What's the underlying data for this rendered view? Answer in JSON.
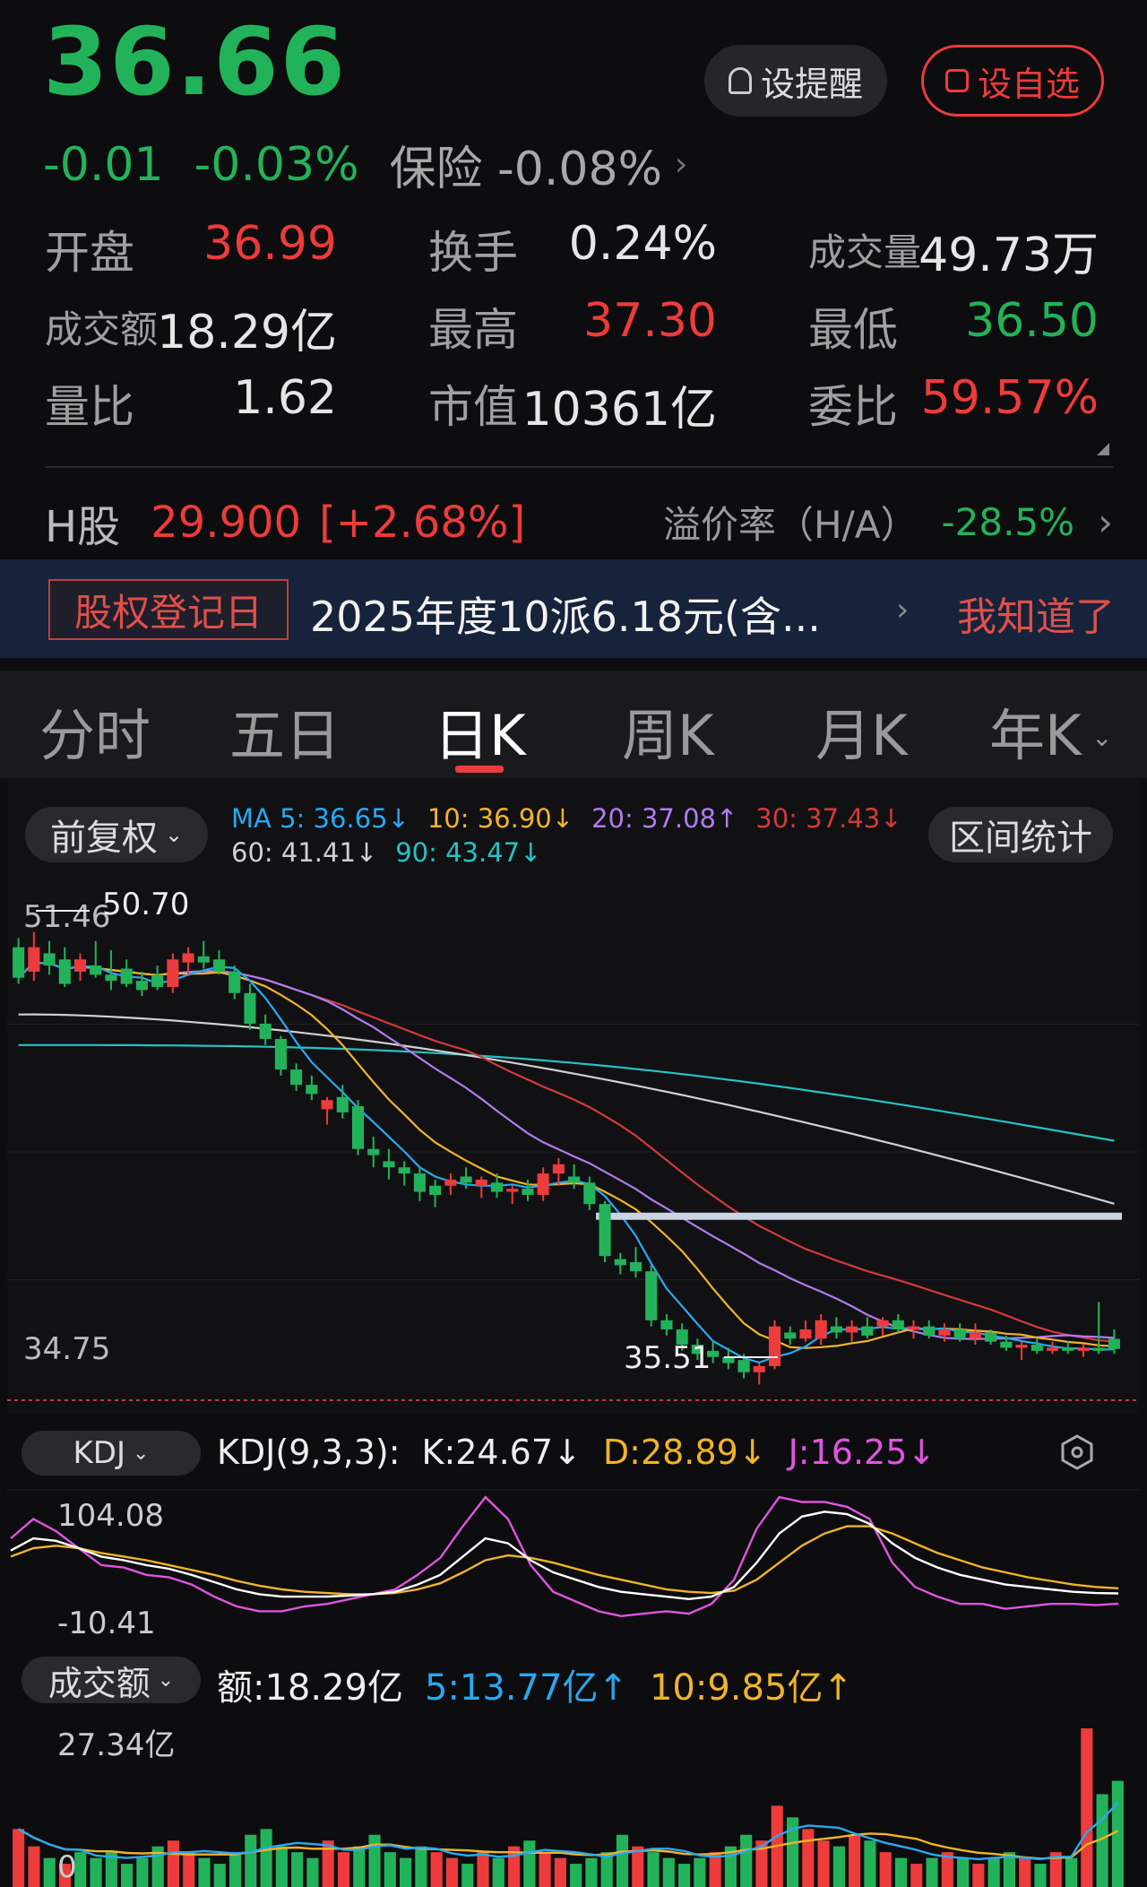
{
  "header": {
    "price": "36.66",
    "change": "-0.01",
    "change_pct": "-0.03%",
    "sector": "保险 -0.08%",
    "chevron": "›",
    "alert_button": "设提醒",
    "fav_button": "设自选"
  },
  "stats": [
    {
      "label": "开盘",
      "value": "36.99",
      "color": "#ee3b3b"
    },
    {
      "label": "换手",
      "value": "0.24%",
      "color": "#e6e6e6"
    },
    {
      "label": "成交量",
      "value": "49.73万",
      "color": "#e6e6e6"
    },
    {
      "label": "成交额",
      "value": "18.29亿",
      "color": "#e6e6e6"
    },
    {
      "label": "最高",
      "value": "37.30",
      "color": "#ee3b3b"
    },
    {
      "label": "最低",
      "value": "36.50",
      "color": "#22b35a"
    },
    {
      "label": "量比",
      "value": "1.62",
      "color": "#e6e6e6"
    },
    {
      "label": "市值",
      "value": "10361亿",
      "color": "#e6e6e6"
    },
    {
      "label": "委比",
      "value": "59.57%",
      "color": "#ee3b3b"
    }
  ],
  "hshare": {
    "label": "H股",
    "price": "29.900",
    "change": "[+2.68%]",
    "premium_label": "溢价率（H/A）",
    "premium_value": "-28.5%",
    "chevron": "›"
  },
  "banner": {
    "tag": "股权登记日",
    "text": "2025年度10派6.18元(含...",
    "chevron": "›",
    "dismiss": "我知道了"
  },
  "tabs": {
    "items": [
      "分时",
      "五日",
      "日K",
      "周K",
      "月K",
      "年K"
    ],
    "active": "日K",
    "more_icon": "chevron-down-icon"
  },
  "kline": {
    "adjust_button": "前复权",
    "range_button": "区间统计",
    "ma": {
      "ma5": "MA 5: 36.65↓",
      "ma10": "10: 36.90↓",
      "ma20": "20: 37.08↑",
      "ma30": "30: 37.43↓",
      "ma60": "60: 41.41↓",
      "ma90": "90: 43.47↓"
    },
    "top_left_price": "51.46",
    "high_label": "50.70",
    "bottom_left_price": "34.75",
    "low_label": "35.51",
    "colors": {
      "ma5": "#2aa8f0",
      "ma10": "#f0b429",
      "ma20": "#b07cf0",
      "ma30": "#d33a3a",
      "ma60": "#d0d0d0",
      "ma90": "#27c2c2",
      "up": "#ee3b3b",
      "down": "#22b35a"
    }
  },
  "kdj": {
    "button": "KDJ",
    "params": "KDJ(9,3,3):",
    "k": "K:24.67↓",
    "d": "D:28.89↓",
    "j": "J:16.25↓",
    "max_label": "104.08",
    "min_label": "-10.41",
    "settings_icon": "hexagon-settings-icon"
  },
  "volume": {
    "button": "成交额",
    "amount": "额:18.29亿",
    "ma5": "5:13.77亿↑",
    "ma10": "10:9.85亿↑",
    "max_label": "27.34亿",
    "zero_label": "0"
  },
  "chart_data": {
    "type": "line",
    "title": "",
    "xlabel": "",
    "ylabel": "",
    "ylim": [
      34.75,
      51.46
    ],
    "candles": [
      {
        "o": 49.8,
        "h": 50.1,
        "l": 48.6,
        "c": 48.8
      },
      {
        "o": 49.0,
        "h": 50.3,
        "l": 48.7,
        "c": 49.8
      },
      {
        "o": 49.6,
        "h": 50.0,
        "l": 48.9,
        "c": 49.2
      },
      {
        "o": 49.4,
        "h": 49.8,
        "l": 48.5,
        "c": 48.6
      },
      {
        "o": 49.0,
        "h": 49.6,
        "l": 48.7,
        "c": 49.4
      },
      {
        "o": 49.2,
        "h": 50.0,
        "l": 48.8,
        "c": 48.9
      },
      {
        "o": 48.9,
        "h": 49.7,
        "l": 48.4,
        "c": 48.7
      },
      {
        "o": 49.1,
        "h": 49.4,
        "l": 48.5,
        "c": 48.6
      },
      {
        "o": 48.7,
        "h": 49.0,
        "l": 48.2,
        "c": 48.4
      },
      {
        "o": 48.9,
        "h": 49.2,
        "l": 48.4,
        "c": 48.5
      },
      {
        "o": 48.5,
        "h": 49.6,
        "l": 48.3,
        "c": 49.4
      },
      {
        "o": 49.3,
        "h": 49.8,
        "l": 48.9,
        "c": 49.6
      },
      {
        "o": 49.5,
        "h": 50.0,
        "l": 49.1,
        "c": 49.3
      },
      {
        "o": 49.4,
        "h": 49.7,
        "l": 48.9,
        "c": 49.0
      },
      {
        "o": 49.0,
        "h": 49.2,
        "l": 48.1,
        "c": 48.3
      },
      {
        "o": 48.3,
        "h": 48.6,
        "l": 47.1,
        "c": 47.3
      },
      {
        "o": 47.3,
        "h": 47.6,
        "l": 46.6,
        "c": 46.8
      },
      {
        "o": 46.8,
        "h": 46.9,
        "l": 45.6,
        "c": 45.8
      },
      {
        "o": 45.8,
        "h": 46.0,
        "l": 45.1,
        "c": 45.3
      },
      {
        "o": 45.3,
        "h": 45.6,
        "l": 44.8,
        "c": 45.0
      },
      {
        "o": 44.5,
        "h": 44.9,
        "l": 44.0,
        "c": 44.8
      },
      {
        "o": 44.9,
        "h": 45.3,
        "l": 44.2,
        "c": 44.4
      },
      {
        "o": 44.6,
        "h": 44.8,
        "l": 43.0,
        "c": 43.2
      },
      {
        "o": 43.2,
        "h": 43.6,
        "l": 42.6,
        "c": 43.0
      },
      {
        "o": 42.8,
        "h": 43.2,
        "l": 42.2,
        "c": 42.6
      },
      {
        "o": 42.6,
        "h": 42.8,
        "l": 42.0,
        "c": 42.4
      },
      {
        "o": 42.4,
        "h": 42.6,
        "l": 41.5,
        "c": 41.8
      },
      {
        "o": 42.0,
        "h": 42.2,
        "l": 41.3,
        "c": 41.7
      },
      {
        "o": 42.0,
        "h": 42.4,
        "l": 41.7,
        "c": 42.2
      },
      {
        "o": 42.3,
        "h": 42.6,
        "l": 41.9,
        "c": 42.1
      },
      {
        "o": 42.0,
        "h": 42.3,
        "l": 41.6,
        "c": 42.2
      },
      {
        "o": 42.1,
        "h": 42.4,
        "l": 41.6,
        "c": 41.8
      },
      {
        "o": 41.8,
        "h": 42.0,
        "l": 41.4,
        "c": 41.9
      },
      {
        "o": 41.9,
        "h": 42.2,
        "l": 41.5,
        "c": 41.7
      },
      {
        "o": 41.7,
        "h": 42.6,
        "l": 41.5,
        "c": 42.4
      },
      {
        "o": 42.4,
        "h": 42.9,
        "l": 42.0,
        "c": 42.7
      },
      {
        "o": 42.3,
        "h": 42.7,
        "l": 41.9,
        "c": 42.1
      },
      {
        "o": 42.1,
        "h": 42.3,
        "l": 41.2,
        "c": 41.4
      },
      {
        "o": 41.4,
        "h": 41.5,
        "l": 39.5,
        "c": 39.7
      },
      {
        "o": 39.6,
        "h": 39.8,
        "l": 39.1,
        "c": 39.4
      },
      {
        "o": 39.5,
        "h": 40.0,
        "l": 39.0,
        "c": 39.2
      },
      {
        "o": 39.2,
        "h": 39.4,
        "l": 37.4,
        "c": 37.6
      },
      {
        "o": 37.6,
        "h": 37.8,
        "l": 37.1,
        "c": 37.3
      },
      {
        "o": 37.3,
        "h": 37.5,
        "l": 36.6,
        "c": 36.8
      },
      {
        "o": 36.8,
        "h": 37.0,
        "l": 36.3,
        "c": 36.5
      },
      {
        "o": 36.6,
        "h": 36.9,
        "l": 36.2,
        "c": 36.4
      },
      {
        "o": 36.4,
        "h": 36.7,
        "l": 36.0,
        "c": 36.2
      },
      {
        "o": 36.3,
        "h": 36.5,
        "l": 35.7,
        "c": 35.9
      },
      {
        "o": 35.9,
        "h": 36.2,
        "l": 35.5,
        "c": 36.1
      },
      {
        "o": 36.1,
        "h": 37.6,
        "l": 36.0,
        "c": 37.4
      },
      {
        "o": 37.2,
        "h": 37.4,
        "l": 36.8,
        "c": 37.0
      },
      {
        "o": 37.0,
        "h": 37.6,
        "l": 36.9,
        "c": 37.3
      },
      {
        "o": 37.0,
        "h": 37.8,
        "l": 36.8,
        "c": 37.6
      },
      {
        "o": 37.4,
        "h": 37.7,
        "l": 37.0,
        "c": 37.2
      },
      {
        "o": 37.2,
        "h": 37.6,
        "l": 36.9,
        "c": 37.4
      },
      {
        "o": 37.4,
        "h": 37.7,
        "l": 37.0,
        "c": 37.1
      },
      {
        "o": 37.4,
        "h": 37.7,
        "l": 37.1,
        "c": 37.6
      },
      {
        "o": 37.6,
        "h": 37.8,
        "l": 37.2,
        "c": 37.3
      },
      {
        "o": 37.3,
        "h": 37.6,
        "l": 37.0,
        "c": 37.4
      },
      {
        "o": 37.4,
        "h": 37.6,
        "l": 37.0,
        "c": 37.1
      },
      {
        "o": 37.1,
        "h": 37.5,
        "l": 36.9,
        "c": 37.3
      },
      {
        "o": 37.3,
        "h": 37.5,
        "l": 36.9,
        "c": 37.0
      },
      {
        "o": 37.0,
        "h": 37.5,
        "l": 36.8,
        "c": 37.2
      },
      {
        "o": 37.2,
        "h": 37.3,
        "l": 36.8,
        "c": 36.9
      },
      {
        "o": 36.9,
        "h": 37.1,
        "l": 36.6,
        "c": 36.7
      },
      {
        "o": 36.7,
        "h": 36.9,
        "l": 36.3,
        "c": 36.8
      },
      {
        "o": 36.8,
        "h": 37.0,
        "l": 36.5,
        "c": 36.6
      },
      {
        "o": 36.6,
        "h": 36.9,
        "l": 36.5,
        "c": 36.7
      },
      {
        "o": 36.7,
        "h": 36.9,
        "l": 36.5,
        "c": 36.6
      },
      {
        "o": 36.6,
        "h": 36.8,
        "l": 36.4,
        "c": 36.7
      },
      {
        "o": 36.7,
        "h": 38.2,
        "l": 36.5,
        "c": 36.6
      },
      {
        "o": 36.99,
        "h": 37.3,
        "l": 36.5,
        "c": 36.66
      }
    ],
    "ma_levels": {
      "ma5_end": 36.65,
      "ma10_end": 36.9,
      "ma20_end": 37.08,
      "ma30_end": 37.43,
      "ma60_end": 41.41,
      "ma90_end": 43.47
    },
    "resistance_line": 41.0,
    "kdj": {
      "k": [
        60,
        70,
        68,
        62,
        55,
        52,
        48,
        45,
        40,
        34,
        28,
        24,
        22,
        22,
        22,
        23,
        24,
        26,
        32,
        40,
        55,
        70,
        66,
        52,
        42,
        36,
        30,
        26,
        24,
        22,
        20,
        22,
        30,
        50,
        74,
        88,
        92,
        90,
        82,
        66,
        54,
        46,
        40,
        36,
        32,
        30,
        28,
        26,
        25,
        24.67
      ],
      "d": [
        55,
        62,
        64,
        62,
        58,
        55,
        52,
        48,
        44,
        40,
        35,
        31,
        28,
        26,
        25,
        24,
        24,
        25,
        28,
        33,
        42,
        52,
        56,
        54,
        50,
        45,
        40,
        36,
        32,
        28,
        26,
        25,
        27,
        36,
        50,
        64,
        74,
        80,
        80,
        74,
        66,
        58,
        52,
        46,
        42,
        38,
        35,
        32,
        30,
        28.89
      ],
      "j": [
        70,
        86,
        76,
        62,
        48,
        46,
        40,
        38,
        32,
        22,
        14,
        10,
        10,
        14,
        16,
        20,
        24,
        28,
        40,
        54,
        80,
        104,
        86,
        48,
        26,
        18,
        10,
        6,
        8,
        10,
        8,
        16,
        36,
        78,
        104,
        100,
        100,
        96,
        86,
        50,
        30,
        22,
        16,
        16,
        12,
        14,
        16,
        16,
        15,
        16.25
      ],
      "ylim": [
        -10.41,
        104.08
      ]
    },
    "volume": {
      "values": [
        10,
        7,
        5,
        4,
        6,
        5,
        6,
        4,
        5,
        7,
        8,
        6,
        5,
        4,
        6,
        9,
        10,
        7,
        6,
        5,
        8,
        6,
        7,
        9,
        6,
        5,
        7,
        6,
        5,
        4,
        6,
        5,
        7,
        8,
        6,
        5,
        4,
        5,
        6,
        9,
        7,
        6,
        5,
        4,
        5,
        6,
        7,
        9,
        8,
        14,
        12,
        10,
        8,
        7,
        9,
        8,
        6,
        5,
        4,
        5,
        6,
        5,
        4,
        5,
        6,
        5,
        4,
        6,
        5,
        27.34,
        16,
        18.29
      ],
      "up": [
        true,
        true,
        false,
        true,
        false,
        false,
        false,
        false,
        false,
        false,
        true,
        true,
        false,
        false,
        false,
        false,
        false,
        false,
        false,
        false,
        true,
        true,
        false,
        false,
        false,
        false,
        false,
        true,
        true,
        false,
        true,
        false,
        true,
        false,
        true,
        true,
        false,
        false,
        false,
        false,
        true,
        false,
        false,
        false,
        false,
        true,
        false,
        false,
        true,
        true,
        false,
        true,
        true,
        false,
        true,
        false,
        true,
        false,
        true,
        false,
        true,
        false,
        true,
        false,
        false,
        true,
        false,
        true,
        false,
        true,
        false,
        false
      ],
      "ylim": [
        0,
        27.34
      ]
    }
  }
}
